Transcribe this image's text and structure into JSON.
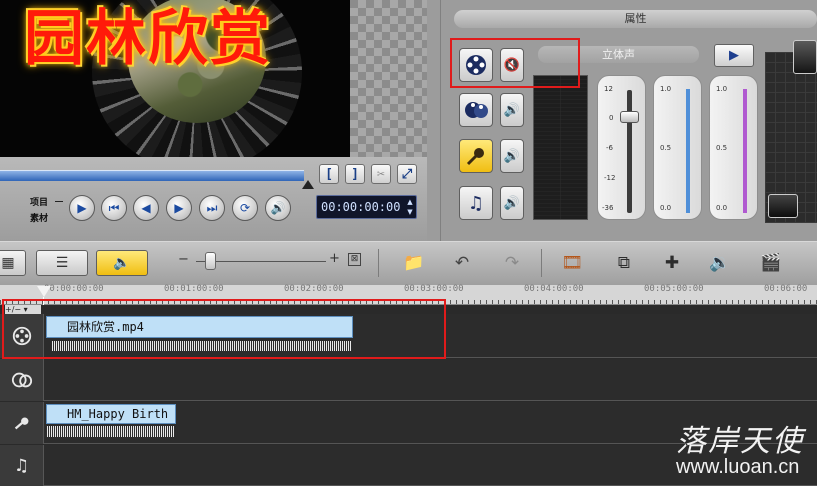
{
  "preview": {
    "title_text": "园林欣赏"
  },
  "playback": {
    "project_label": "项目",
    "clip_label": "素材",
    "timecode": "00:00:00:00",
    "buttons": {
      "mark_in": "[",
      "mark_out": "]",
      "cut": "✂",
      "expand": "⤢"
    },
    "controls": {
      "play": "▶",
      "start": "⏮",
      "prev_frame": "◀",
      "next_frame": "▶",
      "end": "⏭",
      "repeat": "⟳",
      "volume": "🔊"
    }
  },
  "properties": {
    "header": "属性",
    "stereo_label": "立体声",
    "slider_scale": [
      "12",
      "0",
      "-6",
      "-12",
      "-36"
    ],
    "left_meter_scale": [
      "1.0",
      "0.5",
      "0.0"
    ],
    "right_meter_scale": [
      "1.0",
      "0.5",
      "0.0"
    ],
    "track_buttons": [
      "video-track",
      "overlay-track",
      "voice-track",
      "music-track"
    ]
  },
  "toolbar": {
    "zoom_out": "−",
    "zoom_in": "+"
  },
  "timeline": {
    "ruler_labels": [
      "00:00:00:00",
      "00:01:00:00",
      "00:02:00:00",
      "00:03:00:00",
      "00:04:00:00",
      "00:05:00:00",
      "00:06:00"
    ],
    "mini_label": "+/− ▾",
    "video_clip_name": "园林欣赏.mp4",
    "voice_clip_name": "HM_Happy Birth"
  },
  "watermark": {
    "brand_cn": "落岸天使",
    "url": "www.luoan.cn"
  },
  "colors": {
    "highlight_box": "#e01b1b",
    "clip_fill": "#bfe0f7",
    "audio_active": "#f0be12"
  }
}
